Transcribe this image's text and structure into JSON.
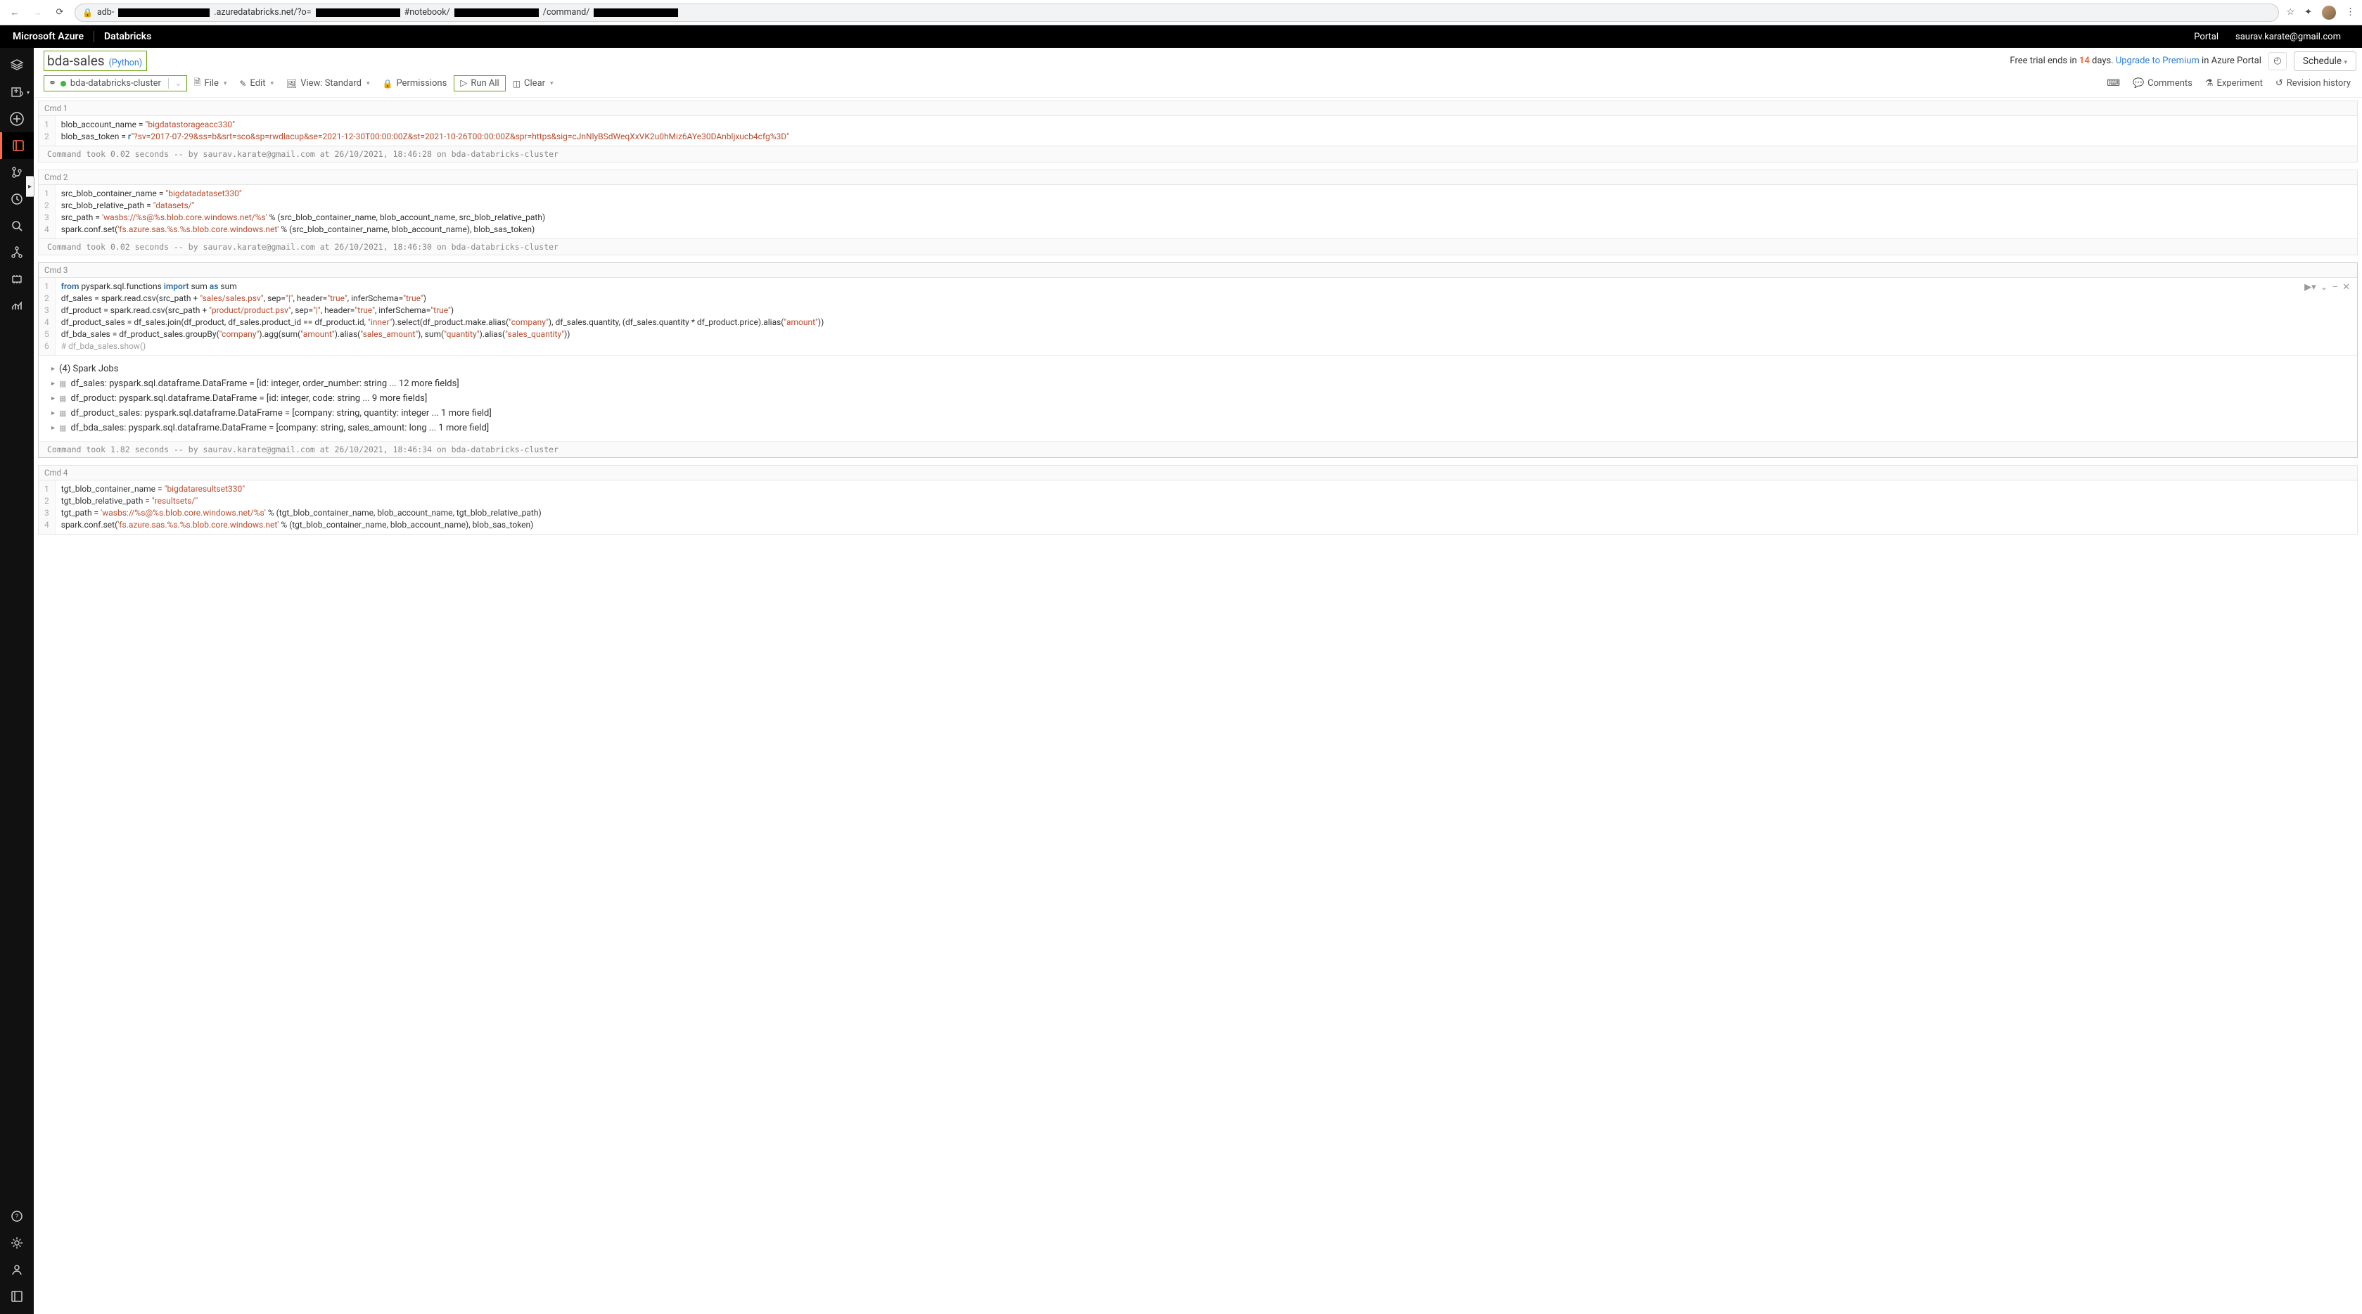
{
  "chrome": {
    "url_parts": [
      "adb-",
      ".azuredatabricks.net/?o=",
      "#notebook/",
      "/command/"
    ],
    "star": "☆"
  },
  "azure": {
    "brand1": "Microsoft Azure",
    "brand2": "Databricks",
    "portal": "Portal",
    "email": "saurav.karate@gmail.com"
  },
  "notebook": {
    "name": "bda-sales",
    "lang": "(Python)",
    "cluster_name": "bda-databricks-cluster",
    "trial_pre": "Free trial ends in ",
    "trial_days": "14",
    "trial_mid": " days. ",
    "upgrade": "Upgrade to Premium",
    "trial_post": " in Azure Portal",
    "schedule": "Schedule"
  },
  "toolbar": {
    "file": "File",
    "edit": "Edit",
    "view": "View: Standard",
    "perm": "Permissions",
    "runall": "Run All",
    "clear": "Clear",
    "comments": "Comments",
    "experiment": "Experiment",
    "revhist": "Revision history"
  },
  "cells": [
    {
      "label": "Cmd 1",
      "meta": "Command took 0.02 seconds -- by saurav.karate@gmail.com at 26/10/2021, 18:46:28 on bda-databricks-cluster",
      "lines": [
        [
          [
            "var",
            "blob_account_name = "
          ],
          [
            "str",
            "\"bigdatastorageacc330\""
          ]
        ],
        [
          [
            "var",
            "blob_sas_token = "
          ],
          [
            "kw",
            "r"
          ],
          [
            "str",
            "\"?sv=2017-07-29&ss=b&srt=sco&sp=rwdlacup&se=2021-12-30T00:00:00Z&st=2021-10-26T00:00:00Z&spr=https&sig=cJnNlyBSdWeqXxVK2u0hMiz6AYe30DAnbljxucb4cfg%3D\""
          ]
        ]
      ]
    },
    {
      "label": "Cmd 2",
      "meta": "Command took 0.02 seconds -- by saurav.karate@gmail.com at 26/10/2021, 18:46:30 on bda-databricks-cluster",
      "lines": [
        [
          [
            "var",
            "src_blob_container_name = "
          ],
          [
            "str",
            "\"bigdatadataset330\""
          ]
        ],
        [
          [
            "var",
            "src_blob_relative_path = "
          ],
          [
            "str",
            "\"datasets/\""
          ]
        ],
        [
          [
            "var",
            "src_path = "
          ],
          [
            "str",
            "'wasbs://%s@%s.blob.core.windows.net/%s'"
          ],
          [
            "var",
            " % (src_blob_container_name, blob_account_name, src_blob_relative_path)"
          ]
        ],
        [
          [
            "var",
            "spark.conf.set("
          ],
          [
            "str",
            "'fs.azure.sas.%s.%s.blob.core.windows.net'"
          ],
          [
            "var",
            " % (src_blob_container_name, blob_account_name), blob_sas_token)"
          ]
        ]
      ]
    },
    {
      "label": "Cmd 3",
      "meta": "Command took 1.82 seconds -- by saurav.karate@gmail.com at 26/10/2021, 18:46:34 on bda-databricks-cluster",
      "lines": [
        [
          [
            "kw",
            "from"
          ],
          [
            "var",
            " pyspark.sql.functions "
          ],
          [
            "kw",
            "import"
          ],
          [
            "var",
            " sum "
          ],
          [
            "kw",
            "as"
          ],
          [
            "var",
            " sum"
          ]
        ],
        [
          [
            "var",
            "df_sales = spark.read.csv(src_path + "
          ],
          [
            "str",
            "\"sales/sales.psv\""
          ],
          [
            "var",
            ", sep="
          ],
          [
            "str",
            "\"|\""
          ],
          [
            "var",
            ", header="
          ],
          [
            "str",
            "\"true\""
          ],
          [
            "var",
            ", inferSchema="
          ],
          [
            "str",
            "\"true\""
          ],
          [
            "var",
            ")"
          ]
        ],
        [
          [
            "var",
            "df_product = spark.read.csv(src_path + "
          ],
          [
            "str",
            "\"product/product.psv\""
          ],
          [
            "var",
            ", sep="
          ],
          [
            "str",
            "\"|\""
          ],
          [
            "var",
            ", header="
          ],
          [
            "str",
            "\"true\""
          ],
          [
            "var",
            ", inferSchema="
          ],
          [
            "str",
            "\"true\""
          ],
          [
            "var",
            ")"
          ]
        ],
        [
          [
            "var",
            "df_product_sales = df_sales.join(df_product, df_sales.product_id == df_product.id, "
          ],
          [
            "str",
            "\"inner\""
          ],
          [
            "var",
            ").select(df_product.make.alias("
          ],
          [
            "str",
            "\"company\""
          ],
          [
            "var",
            "), df_sales.quantity, (df_sales.quantity * df_product.price).alias("
          ],
          [
            "str",
            "\"amount\""
          ],
          [
            "var",
            "))"
          ]
        ],
        [
          [
            "var",
            "df_bda_sales = df_product_sales.groupBy("
          ],
          [
            "str",
            "\"company\""
          ],
          [
            "var",
            ").agg(sum("
          ],
          [
            "str",
            "\"amount\""
          ],
          [
            "var",
            ").alias("
          ],
          [
            "str",
            "\"sales_amount\""
          ],
          [
            "var",
            "), sum("
          ],
          [
            "str",
            "\"quantity\""
          ],
          [
            "var",
            ").alias("
          ],
          [
            "str",
            "\"sales_quantity\""
          ],
          [
            "var",
            "))"
          ]
        ],
        [
          [
            "cmt",
            "# df_bda_sales.show()"
          ]
        ]
      ],
      "output_lines": [
        "(4) Spark Jobs",
        "df_sales:  pyspark.sql.dataframe.DataFrame = [id: integer, order_number: string ... 12 more fields]",
        "df_product:  pyspark.sql.dataframe.DataFrame = [id: integer, code: string ... 9 more fields]",
        "df_product_sales:  pyspark.sql.dataframe.DataFrame = [company: string, quantity: integer ... 1 more field]",
        "df_bda_sales:  pyspark.sql.dataframe.DataFrame = [company: string, sales_amount: long ... 1 more field]"
      ]
    },
    {
      "label": "Cmd 4",
      "lines": [
        [
          [
            "var",
            "tgt_blob_container_name = "
          ],
          [
            "str",
            "\"bigdataresultset330\""
          ]
        ],
        [
          [
            "var",
            "tgt_blob_relative_path = "
          ],
          [
            "str",
            "\"resultsets/\""
          ]
        ],
        [
          [
            "var",
            "tgt_path = "
          ],
          [
            "str",
            "'wasbs://%s@%s.blob.core.windows.net/%s'"
          ],
          [
            "var",
            " % (tgt_blob_container_name, blob_account_name, tgt_blob_relative_path)"
          ]
        ],
        [
          [
            "var",
            "spark.conf.set("
          ],
          [
            "str",
            "'fs.azure.sas.%s.%s.blob.core.windows.net'"
          ],
          [
            "var",
            " % (tgt_blob_container_name, blob_account_name), blob_sas_token)"
          ]
        ]
      ]
    }
  ]
}
